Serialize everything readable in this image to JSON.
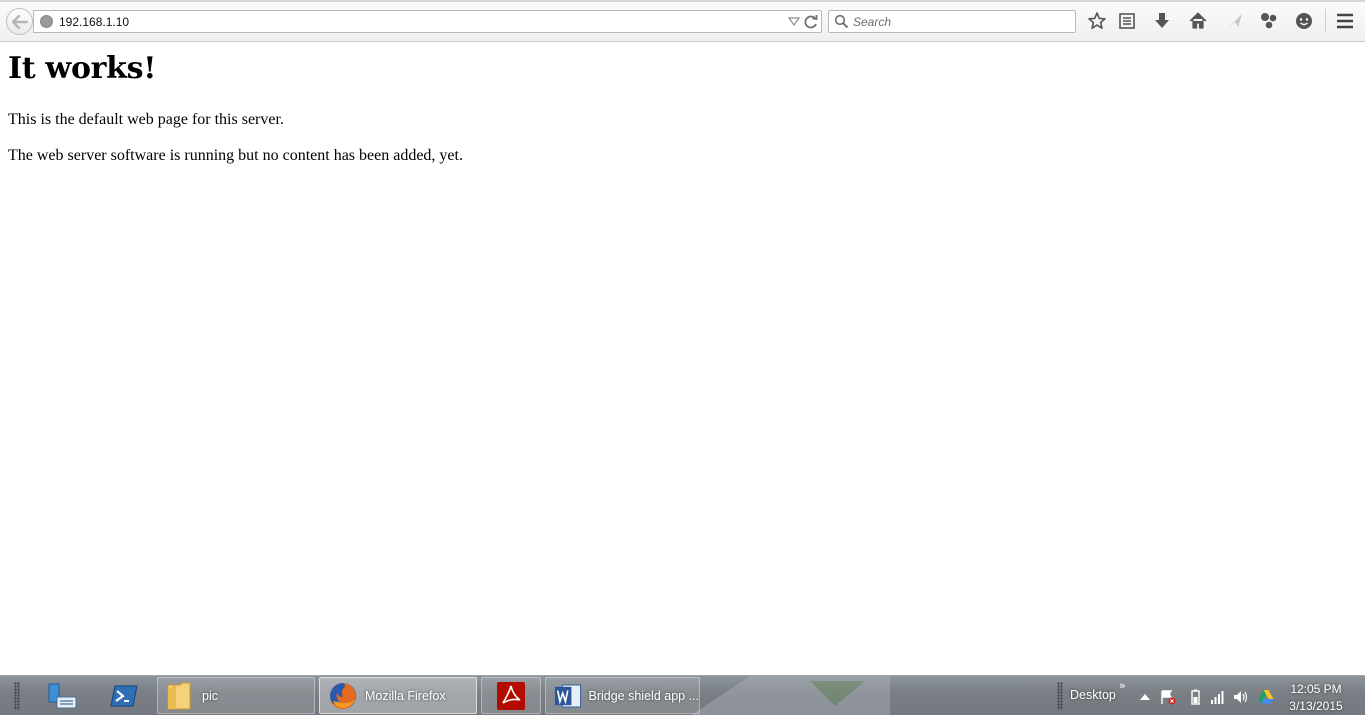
{
  "browser": {
    "url": "192.168.1.10",
    "search_placeholder": "Search"
  },
  "page": {
    "heading": "It works!",
    "paragraphs": [
      "This is the default web page for this server.",
      "The web server software is running but no content has been added, yet."
    ]
  },
  "taskbar": {
    "buttons": [
      {
        "label": "pic",
        "icon": "folder-icon"
      },
      {
        "label": "Mozilla Firefox",
        "icon": "firefox-icon",
        "active": true
      },
      {
        "label": "",
        "icon": "acrobat-icon"
      },
      {
        "label": "Bridge shield app ...",
        "icon": "word-icon"
      }
    ],
    "desktop_toolbar": "Desktop",
    "desktop_chevron": "»",
    "clock": {
      "time": "12:05 PM",
      "date": "3/13/2015"
    }
  }
}
